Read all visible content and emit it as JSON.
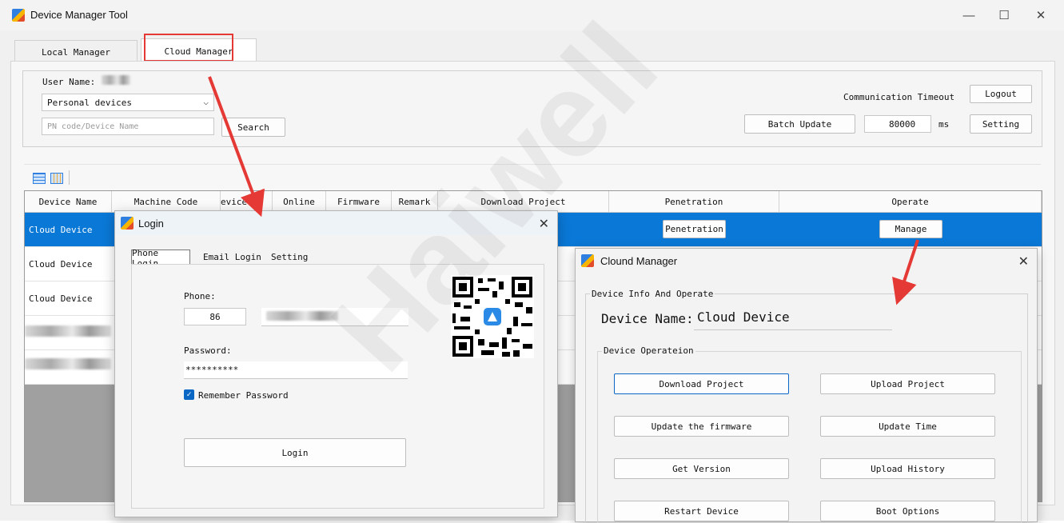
{
  "window": {
    "title": "Device Manager Tool",
    "minimize": "—",
    "maximize": "☐",
    "close": "✕"
  },
  "tabs": [
    {
      "label": "Local Manager"
    },
    {
      "label": "Cloud Manager"
    }
  ],
  "cloud": {
    "user_name_label": "User Name:",
    "device_filter": "Personal devices",
    "search_placeholder": "PN code/Device Name",
    "search_button": "Search",
    "comm_timeout_label": "Communication Timeout",
    "logout_button": "Logout",
    "batch_update_button": "Batch Update",
    "timeout_value": "80000",
    "timeout_unit": "ms",
    "setting_button": "Setting"
  },
  "table": {
    "columns": [
      "Device Name",
      "Machine Code",
      "evice⇥p",
      "Online",
      "Firmware",
      "Remark",
      "Download Project",
      "Penetration",
      "Operate"
    ],
    "rows": [
      {
        "device_name": "Cloud Device",
        "penetration": "Penetration",
        "operate": "Manage"
      },
      {
        "device_name": "Cloud Device"
      },
      {
        "device_name": "Cloud Device"
      }
    ]
  },
  "login": {
    "title": "Login",
    "tabs": [
      "Phone Login",
      "Email Login",
      "Setting"
    ],
    "phone_label": "Phone:",
    "country_code": "86",
    "password_label": "Password:",
    "password_value": "**********",
    "remember_label": "Remember Password",
    "login_button": "Login",
    "close": "✕"
  },
  "manager": {
    "title": "Clound Manager",
    "group_info": "Device Info And Operate",
    "device_name_label": "Device Name:",
    "device_name_value": "Cloud Device",
    "group_ops": "Device Operateion",
    "buttons": [
      "Download Project",
      "Upload Project",
      "Update the firmware",
      "Update Time",
      "Get Version",
      "Upload History",
      "Restart Device",
      "Boot Options"
    ],
    "close": "✕"
  },
  "watermark": "Haiwell",
  "colors": {
    "selection": "#0a78d7",
    "highlight": "#e53935",
    "arrow": "#e53935"
  }
}
